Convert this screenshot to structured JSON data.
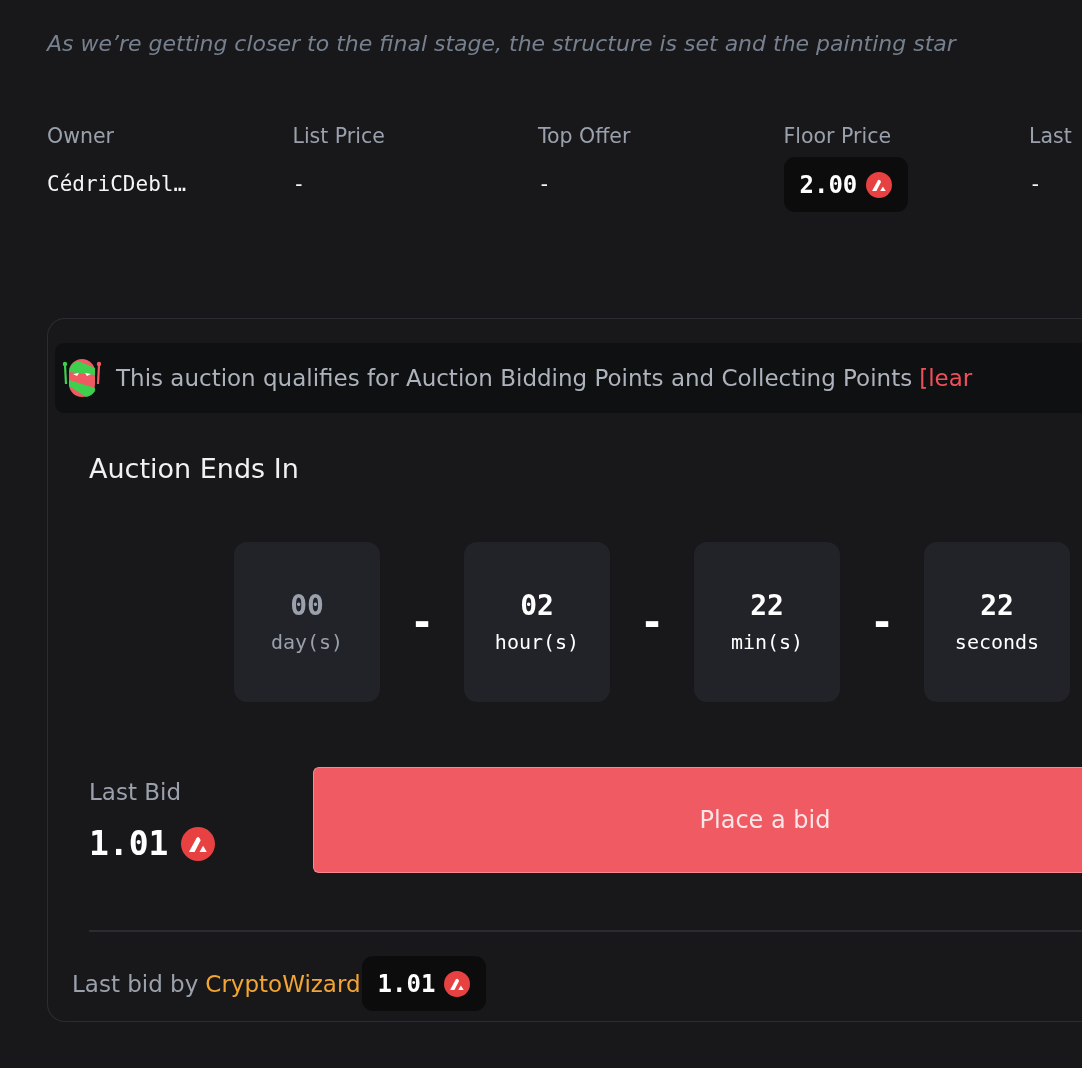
{
  "description": "As we’re getting closer to the final stage, the structure is set and the painting star",
  "stats": [
    {
      "label": "Owner",
      "value": "CédriCDebl…",
      "kind": "text"
    },
    {
      "label": "List Price",
      "value": "-",
      "kind": "text"
    },
    {
      "label": "Top Offer",
      "value": "-",
      "kind": "text"
    },
    {
      "label": "Floor Price",
      "value": "2.00",
      "kind": "price-chip"
    },
    {
      "label": "Last",
      "value": "-",
      "kind": "text"
    }
  ],
  "auction": {
    "banner": {
      "text": "This auction qualifies for Auction Bidding Points and Collecting Points",
      "link": "[lear"
    },
    "title": "Auction Ends In",
    "countdown": [
      {
        "value": "00",
        "unit": "day(s)",
        "dimmed": true
      },
      {
        "value": "02",
        "unit": "hour(s)",
        "dimmed": false
      },
      {
        "value": "22",
        "unit": "min(s)",
        "dimmed": false
      },
      {
        "value": "22",
        "unit": "seconds",
        "dimmed": false
      }
    ],
    "separators": [
      "-",
      "-",
      "-"
    ],
    "last_bid": {
      "label": "Last Bid",
      "value": "1.01"
    },
    "button": "Place a bid",
    "footer": {
      "prefix": "Last bid by",
      "bidder": "CryptoWizard",
      "amount": "1.01"
    }
  }
}
